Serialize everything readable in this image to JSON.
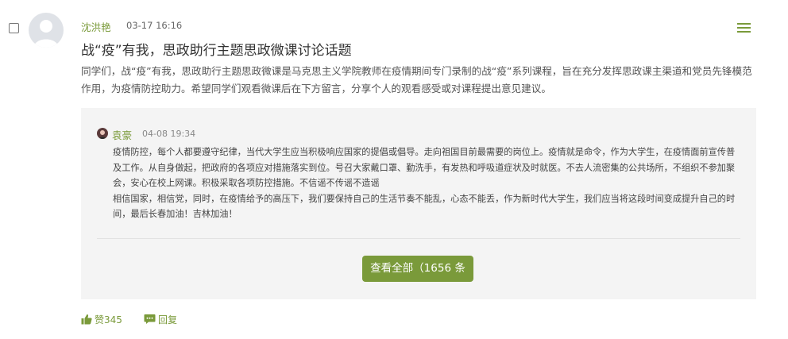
{
  "post": {
    "author": "沈洪艳",
    "time": "03-17 16:16",
    "title": "战“疫”有我，思政助行主题思政微课讨论话题",
    "body": "同学们，战“疫”有我，思政助行主题思政微课是马克思主义学院教师在疫情期间专门录制的战“疫”系列课程，旨在充分发挥思政课主渠道和党员先锋模范作用，为疫情防控助力。希望同学们观看微课后在下方留言，分享个人的观看感受或对课程提出意见建议。"
  },
  "reply": {
    "author": "袁豪",
    "time": "04-08 19:34",
    "paragraph1": "疫情防控，每个人都要遵守纪律，当代大学生应当积极响应国家的提倡或倡导。走向祖国目前最需要的岗位上。疫情就是命令，作为大学生，在疫情面前宣传普及工作。从自身做起，把政府的各项应对措施落实到位。号召大家戴口罩、勤洗手，有发热和呼吸道症状及时就医。不去人流密集的公共场所，不组织不参加聚会，安心在校上网课。积极采取各项防控措施。不信谣不传谣不造谣",
    "paragraph2": "相信国家，相信党，同时，在疫情给予的高压下，我们要保持自己的生活节奏不能乱，心态不能丢，作为新时代大学生，我们应当将这段时间变成提升自己的时间，最后长春加油！吉林加油！"
  },
  "view_all_label": "查看全部（1656 条",
  "actions": {
    "like_label": "赞345",
    "reply_label": "回复"
  },
  "colors": {
    "accent": "#7a9a3a",
    "reply_bg": "#f4f4f4"
  },
  "icons": [
    "menu-icon",
    "thumbs-up-icon",
    "comment-icon",
    "avatar-placeholder"
  ]
}
